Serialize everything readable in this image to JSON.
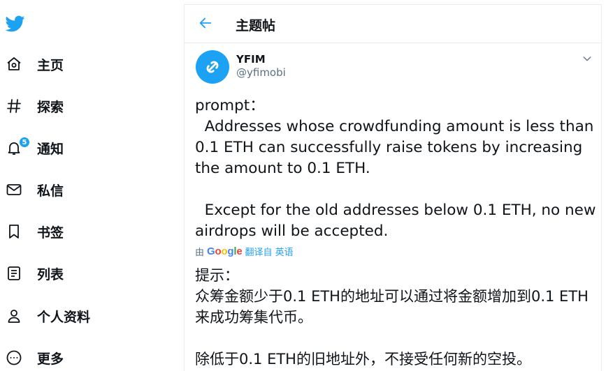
{
  "sidebar": {
    "items": [
      {
        "label": "主页",
        "icon": "home-icon"
      },
      {
        "label": "探索",
        "icon": "hashtag-icon"
      },
      {
        "label": "通知",
        "icon": "bell-icon",
        "badge": "5"
      },
      {
        "label": "私信",
        "icon": "envelope-icon"
      },
      {
        "label": "书签",
        "icon": "bookmark-icon"
      },
      {
        "label": "列表",
        "icon": "list-icon"
      },
      {
        "label": "个人资料",
        "icon": "person-icon"
      },
      {
        "label": "更多",
        "icon": "more-circle-icon"
      }
    ]
  },
  "header": {
    "title": "主题帖"
  },
  "tweet": {
    "display_name": "YFIM",
    "handle": "@yfimobi",
    "text": "prompt：\n  Addresses whose crowdfunding amount is less than 0.1 ETH can successfully raise tokens by increasing the amount to 0.1 ETH.\n\n  Except for the old addresses below 0.1 ETH, no new airdrops will be accepted.",
    "translated_prefix": "由",
    "google_label": "Google",
    "translated_link": "翻译自 英语",
    "translation": "提示：\n众筹金额少于0.1 ETH的地址可以通过将金额增加到0.1 ETH来成功筹集代币。\n\n除低于0.1 ETH的旧地址外，不接受任何新的空投。"
  },
  "colors": {
    "accent": "#1da1f2",
    "text": "#0f1419",
    "secondary": "#5b7083",
    "border": "#e6ecf0"
  }
}
